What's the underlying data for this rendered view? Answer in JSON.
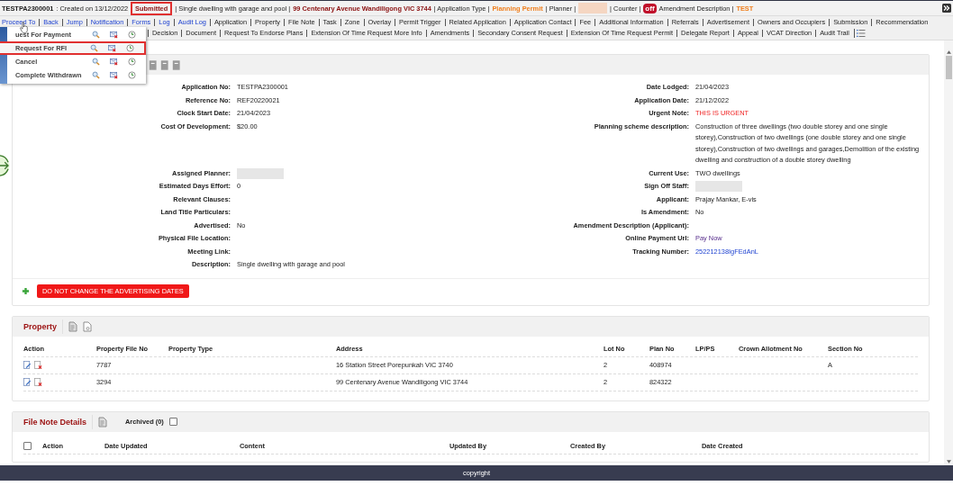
{
  "header": {
    "segments": [
      {
        "kind": "bold",
        "text": "TESTPA2300001"
      },
      {
        "kind": "plain",
        "text": ": Created on 13/12/2022"
      },
      {
        "kind": "status",
        "text": "Submitted"
      },
      {
        "kind": "plain",
        "text": "| Single dwelling with garage and pool |"
      },
      {
        "kind": "address",
        "text": "99 Centenary Avenue Wandiligong VIC 3744"
      },
      {
        "kind": "plain",
        "text": "| Application Type |"
      },
      {
        "kind": "accent",
        "text": "Planning Permit"
      },
      {
        "kind": "plain",
        "text": "| Planner |"
      },
      {
        "kind": "redacted"
      },
      {
        "kind": "plain",
        "text": "| Counter |"
      },
      {
        "kind": "badge",
        "text": "off"
      },
      {
        "kind": "plain",
        "text": "Amendment Description |"
      },
      {
        "kind": "accent",
        "text": "TEST"
      }
    ]
  },
  "nav_rows": [
    [
      {
        "label": "Proceed To",
        "kind": "link"
      },
      {
        "label": "Back",
        "kind": "link"
      },
      {
        "label": "Jump",
        "kind": "link"
      },
      {
        "label": "Notification",
        "kind": "link"
      },
      {
        "label": "Forms",
        "kind": "link"
      },
      {
        "label": "Log",
        "kind": "link"
      },
      {
        "label": "Audit Log",
        "kind": "link"
      },
      {
        "label": "Application",
        "kind": "tab"
      },
      {
        "label": "Property",
        "kind": "tab"
      },
      {
        "label": "File Note",
        "kind": "tab"
      },
      {
        "label": "Task",
        "kind": "tab"
      },
      {
        "label": "Zone",
        "kind": "tab"
      },
      {
        "label": "Overlay",
        "kind": "tab"
      },
      {
        "label": "Permit Trigger",
        "kind": "tab"
      },
      {
        "label": "Related Application",
        "kind": "tab"
      },
      {
        "label": "Application Contact",
        "kind": "tab"
      },
      {
        "label": "Fee",
        "kind": "tab"
      },
      {
        "label": "Additional Information",
        "kind": "tab"
      },
      {
        "label": "Referrals",
        "kind": "tab"
      },
      {
        "label": "Advertisement",
        "kind": "tab"
      },
      {
        "label": "Owners and Occupiers",
        "kind": "tab"
      },
      {
        "label": "Submission",
        "kind": "tab"
      },
      {
        "label": "Recommendation",
        "kind": "tab"
      }
    ],
    [
      {
        "label": "Decision",
        "kind": "tab"
      },
      {
        "label": "Document",
        "kind": "tab"
      },
      {
        "label": "Request To Endorse Plans",
        "kind": "tab"
      },
      {
        "label": "Extension Of Time Request More Info",
        "kind": "tab"
      },
      {
        "label": "Amendments",
        "kind": "tab"
      },
      {
        "label": "Secondary Consent Request",
        "kind": "tab"
      },
      {
        "label": "Extension Of Time Request Permit",
        "kind": "tab"
      },
      {
        "label": "Delegate Report",
        "kind": "tab"
      },
      {
        "label": "Appeal",
        "kind": "tab"
      },
      {
        "label": "VCAT Direction",
        "kind": "tab"
      },
      {
        "label": "Audit Trail",
        "kind": "tab"
      }
    ]
  ],
  "proceed_menu": {
    "items": [
      {
        "label": "uest For Payment",
        "selected": false
      },
      {
        "label": "Request For RFI",
        "selected": true
      },
      {
        "label": "Cancel",
        "selected": false
      },
      {
        "label": "Complete Withdrawn",
        "selected": false
      }
    ]
  },
  "details": {
    "rows": [
      {
        "left": {
          "label": "Application No:",
          "value": "TESTPA2300001",
          "kind": "text"
        },
        "right": {
          "label": "Date Lodged:",
          "value": "21/04/2023",
          "kind": "text"
        }
      },
      {
        "left": {
          "label": "Reference No:",
          "value": "REF20220021",
          "kind": "text"
        },
        "right": {
          "label": "Application Date:",
          "value": "21/12/2022",
          "kind": "text"
        }
      },
      {
        "left": {
          "label": "Clock Start Date:",
          "value": "21/04/2023",
          "kind": "text"
        },
        "right": {
          "label": "Urgent Note:",
          "value": "THIS IS URGENT",
          "kind": "alert"
        }
      },
      {
        "left": {
          "label": "Cost Of Development:",
          "value": "$20.00",
          "kind": "text"
        },
        "right": {
          "label": "Planning scheme description:",
          "value": "Construction of three dwellings (two double storey and one single storey),Construction of two dwellings (one double storey and one single storey),Construction of two dwellings and garages,Demolition of the existing dwelling and construction of a double storey dwelling",
          "kind": "text"
        }
      },
      {
        "left": {
          "label": "Assigned Planner:",
          "kind": "redacted"
        },
        "right": {
          "label": "Current Use:",
          "value": "TWO dwellings",
          "kind": "text"
        }
      },
      {
        "left": {
          "label": "Estimated Days Effort:",
          "value": "0",
          "kind": "text"
        },
        "right": {
          "label": "Sign Off Staff:",
          "kind": "redacted"
        }
      },
      {
        "left": {
          "label": "Relevant Clauses:",
          "kind": "text"
        },
        "right": {
          "label": "Applicant:",
          "value": "Prajay Mankar, E-vis",
          "kind": "text"
        }
      },
      {
        "left": {
          "label": "Land Title Particulars:",
          "kind": "text"
        },
        "right": {
          "label": "Is Amendment:",
          "value": "No",
          "kind": "text"
        }
      },
      {
        "left": {
          "label": "Advertised:",
          "value": "No",
          "kind": "text"
        },
        "right": {
          "label": "Amendment Description (Applicant):",
          "kind": "text"
        }
      },
      {
        "left": {
          "label": "Physical File Location:",
          "kind": "text"
        },
        "right": {
          "label": "Online Payment Url:",
          "value": "Pay Now",
          "kind": "visited"
        }
      },
      {
        "left": {
          "label": "Meeting Link:",
          "kind": "text"
        },
        "right": {
          "label": "Tracking Number:",
          "value": "252212138IgFEdAnL",
          "kind": "link"
        }
      },
      {
        "left": {
          "label": "Description:",
          "value": "Single dwelling with garage and pool",
          "kind": "text"
        }
      }
    ],
    "alert_button": "DO NOT CHANGE THE ADVERTISING DATES"
  },
  "property": {
    "title": "Property",
    "columns": [
      "Action",
      "Property File No",
      "Property Type",
      "Address",
      "Lot No",
      "Plan No",
      "LP/PS",
      "Crown Allotment No",
      "Section No"
    ],
    "rows": [
      [
        "",
        "7787",
        "",
        "16 Station Street Porepunkah VIC 3740",
        "2",
        "408974",
        "",
        "",
        "A"
      ],
      [
        "",
        "3294",
        "",
        "99 Centenary Avenue Wandiligong VIC 3744",
        "2",
        "824322",
        "",
        "",
        ""
      ]
    ]
  },
  "file_notes": {
    "title": "File Note Details",
    "archived": {
      "label": "Archived (0)",
      "checked": false
    },
    "select_all_checked": false,
    "columns": [
      "Action",
      "Date Updated",
      "Content",
      "Updated By",
      "Created By",
      "Date Created"
    ]
  },
  "footer": "copyright"
}
